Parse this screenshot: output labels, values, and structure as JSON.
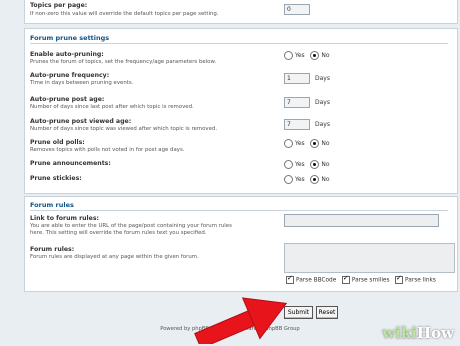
{
  "topics_per_page": {
    "label": "Topics per page:",
    "desc": "If non-zero this value will override the default topics per page setting.",
    "value": "0"
  },
  "prune_section": {
    "title": "Forum prune settings",
    "enable": {
      "label": "Enable auto-pruning:",
      "desc": "Prunes the forum of topics, set the frequency/age parameters below.",
      "yes": "Yes",
      "no": "No",
      "selected": "No"
    },
    "frequency": {
      "label": "Auto-prune frequency:",
      "desc": "Time in days between pruning events.",
      "value": "1",
      "unit": "Days"
    },
    "post_age": {
      "label": "Auto-prune post age:",
      "desc": "Number of days since last post after which topic is removed.",
      "value": "7",
      "unit": "Days"
    },
    "viewed_age": {
      "label": "Auto-prune post viewed age:",
      "desc": "Number of days since topic was viewed after which topic is removed.",
      "value": "7",
      "unit": "Days"
    },
    "old_polls": {
      "label": "Prune old polls:",
      "desc": "Removes topics with polls not voted in for post age days.",
      "yes": "Yes",
      "no": "No",
      "selected": "No"
    },
    "announcements": {
      "label": "Prune announcements:",
      "yes": "Yes",
      "no": "No",
      "selected": "No"
    },
    "stickies": {
      "label": "Prune stickies:",
      "yes": "Yes",
      "no": "No",
      "selected": "No"
    }
  },
  "rules_section": {
    "title": "Forum rules",
    "link": {
      "label": "Link to forum rules:",
      "desc_line1": "You are able to enter the URL of the page/post containing your forum rules",
      "desc_line2": "here. This setting will override the forum rules text you specified.",
      "value": ""
    },
    "rules": {
      "label": "Forum rules:",
      "desc": "Forum rules are displayed at any page within the given forum.",
      "value": "",
      "options": [
        {
          "label": "Parse BBCode",
          "checked": true
        },
        {
          "label": "Parse smilies",
          "checked": true
        },
        {
          "label": "Parse links",
          "checked": true
        }
      ]
    }
  },
  "buttons": {
    "submit": "Submit",
    "reset": "Reset"
  },
  "footer": "Powered by phpBB® Forum Software © phpBB Group",
  "watermark": {
    "wiki": "wiki",
    "how": "How"
  },
  "colors": {
    "header_blue": "#105289",
    "arrow_red": "#e8141b",
    "panel_border": "#c9d3dc"
  },
  "icons": [
    "radio-button",
    "checkbox",
    "red-arrow"
  ]
}
